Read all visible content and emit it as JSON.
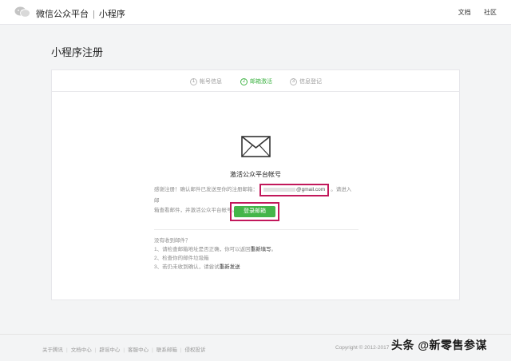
{
  "header": {
    "brand": "微信公众平台",
    "separator": "|",
    "product": "小程序",
    "links": [
      "文档",
      "社区"
    ]
  },
  "page_title": "小程序注册",
  "steps": [
    {
      "num": "1",
      "label": "帐号信息",
      "active": false
    },
    {
      "num": "2",
      "label": "邮箱激活",
      "active": true
    },
    {
      "num": "3",
      "label": "信息登记",
      "active": false
    }
  ],
  "activation": {
    "title": "激活公众平台帐号",
    "desc_prefix": "感谢注册！确认邮件已发送至你的注册邮箱：",
    "email": "@gmail.com",
    "desc_suffix_line1": "。请进入邮",
    "desc_line2": "箱查看邮件，并激活公众平台帐号。",
    "login_button": "登录邮箱"
  },
  "tips": {
    "heading": "没有收到邮件？",
    "item1_prefix": "1、请检查邮箱地址是否正确，你可以返回",
    "item1_link": "重新填写",
    "item1_suffix": "。",
    "item2": "2、检查你的邮件垃圾箱",
    "item3_prefix": "3、若仍未收到确认，请尝试",
    "item3_link": "重新发送"
  },
  "footer": {
    "links": [
      "关于腾讯",
      "文档中心",
      "辟谣中心",
      "客服中心",
      "联系邮箱",
      "侵权投诉"
    ],
    "copyright": "Copyright © 2012-2017"
  },
  "watermark": "头条 @新零售参谋",
  "colors": {
    "accent": "#44b549",
    "highlight": "#c2185b"
  }
}
